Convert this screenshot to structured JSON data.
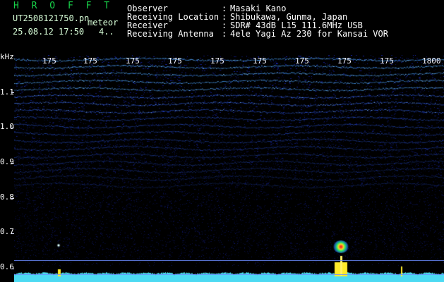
{
  "header": {
    "app_title": "H R O F F T",
    "filename": "UT2508121750.pn",
    "meteor_label": "meteor",
    "datetime": "25.08.12 17:50",
    "count": "4..",
    "observation_info": [
      {
        "label": "Observer",
        "value": "Masaki Kano"
      },
      {
        "label": "Receiving Location",
        "value": "Shibukawa, Gunma, Japan"
      },
      {
        "label": "Receiver",
        "value": "SDR# 43dB L15 111.6MHz USB"
      },
      {
        "label": "Receiving Antenna",
        "value": "4ele Yagi Az 230 for Kansai VOR"
      }
    ],
    "colon": ":"
  },
  "axis": {
    "unit": "kHz",
    "y_ticks": [
      "1.1",
      "1.0",
      "0.9",
      "0.8",
      "0.7",
      "0.6"
    ],
    "x_labels": [
      "175",
      "175",
      "175",
      "175",
      "175",
      "175",
      "175",
      "175",
      "175",
      "1800"
    ]
  },
  "colors": {
    "background": "#000000",
    "spectrogram_primary": "#1d2eff",
    "spectrogram_bright": "#00ffff",
    "signal_hot": "#ff2a2a",
    "text_white": "#ffffff",
    "title_green": "#18d44a"
  }
}
